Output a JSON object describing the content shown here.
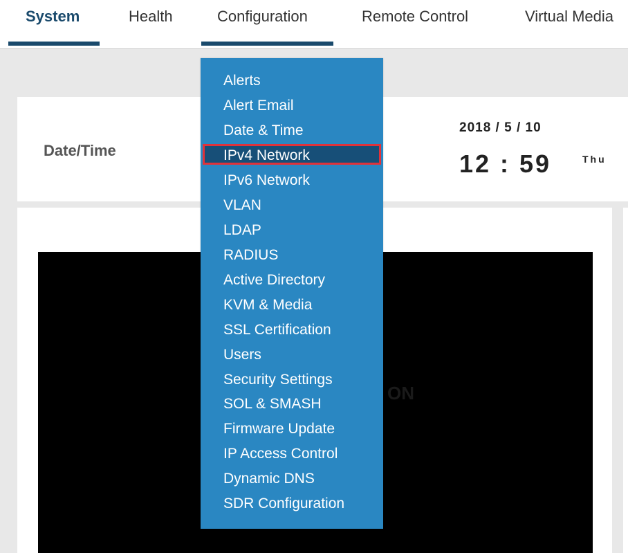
{
  "nav": {
    "tabs": [
      {
        "label": "System",
        "active": true
      },
      {
        "label": "Health",
        "active": false
      },
      {
        "label": "Configuration",
        "active": false,
        "open": true
      },
      {
        "label": "Remote Control",
        "active": false
      },
      {
        "label": "Virtual Media",
        "active": false
      }
    ]
  },
  "datetime": {
    "label": "Date/Time",
    "date": "2018 / 5 / 10",
    "time": "12 : 59",
    "day": "Thu"
  },
  "power": {
    "status": "ON"
  },
  "dropdown": {
    "items": [
      {
        "label": "Alerts"
      },
      {
        "label": "Alert Email"
      },
      {
        "label": "Date & Time"
      },
      {
        "label": "IPv4 Network",
        "highlighted": true
      },
      {
        "label": "IPv6 Network"
      },
      {
        "label": "VLAN"
      },
      {
        "label": "LDAP"
      },
      {
        "label": "RADIUS"
      },
      {
        "label": "Active Directory"
      },
      {
        "label": "KVM & Media"
      },
      {
        "label": "SSL Certification"
      },
      {
        "label": "Users"
      },
      {
        "label": "Security Settings"
      },
      {
        "label": "SOL & SMASH"
      },
      {
        "label": "Firmware Update"
      },
      {
        "label": "IP Access Control"
      },
      {
        "label": "Dynamic DNS"
      },
      {
        "label": "SDR Configuration"
      }
    ]
  },
  "colors": {
    "nav_active": "#1a4a6c",
    "dropdown_bg": "#2a87c2",
    "dropdown_highlight": "#174f78",
    "highlight_border": "#e0323a",
    "content_bg": "#e8e8e8"
  }
}
